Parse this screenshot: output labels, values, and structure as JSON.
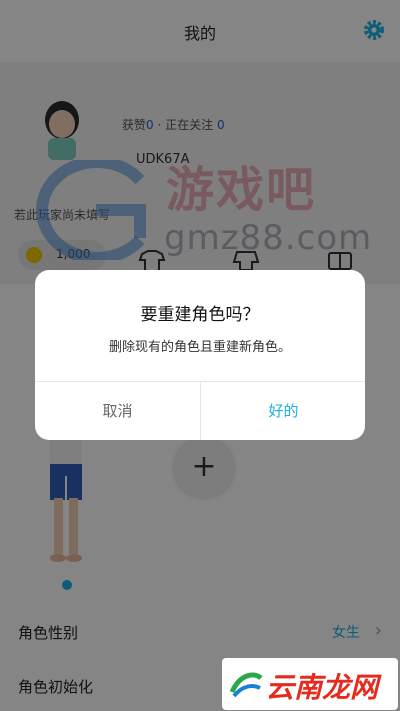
{
  "header": {
    "title": "我的",
    "settings_icon": "gear-icon"
  },
  "profile": {
    "stats_prefix": "获赞",
    "likes": "0",
    "stats_middle": "· 正在关注",
    "following": "0",
    "user_id": "UDK67A",
    "signature": "若此玩家尚未填写",
    "coins": "1,000"
  },
  "character": {
    "add_label": "+"
  },
  "settings_rows": [
    {
      "label": "角色性别",
      "value": "女生",
      "chevron": "›"
    },
    {
      "label": "角色初始化",
      "value": "",
      "chevron": ""
    }
  ],
  "watermark": {
    "site_cn": "游戏吧",
    "site_url": "gmz88.com",
    "bottom_logo": "云南龙网"
  },
  "dialog": {
    "title": "要重建角色吗？",
    "message": "删除现有的角色且重建新角色。",
    "cancel_label": "取消",
    "ok_label": "好的"
  },
  "colors": {
    "accent": "#1ab0e6",
    "overlay": "rgba(0,0,0,0.48)"
  }
}
